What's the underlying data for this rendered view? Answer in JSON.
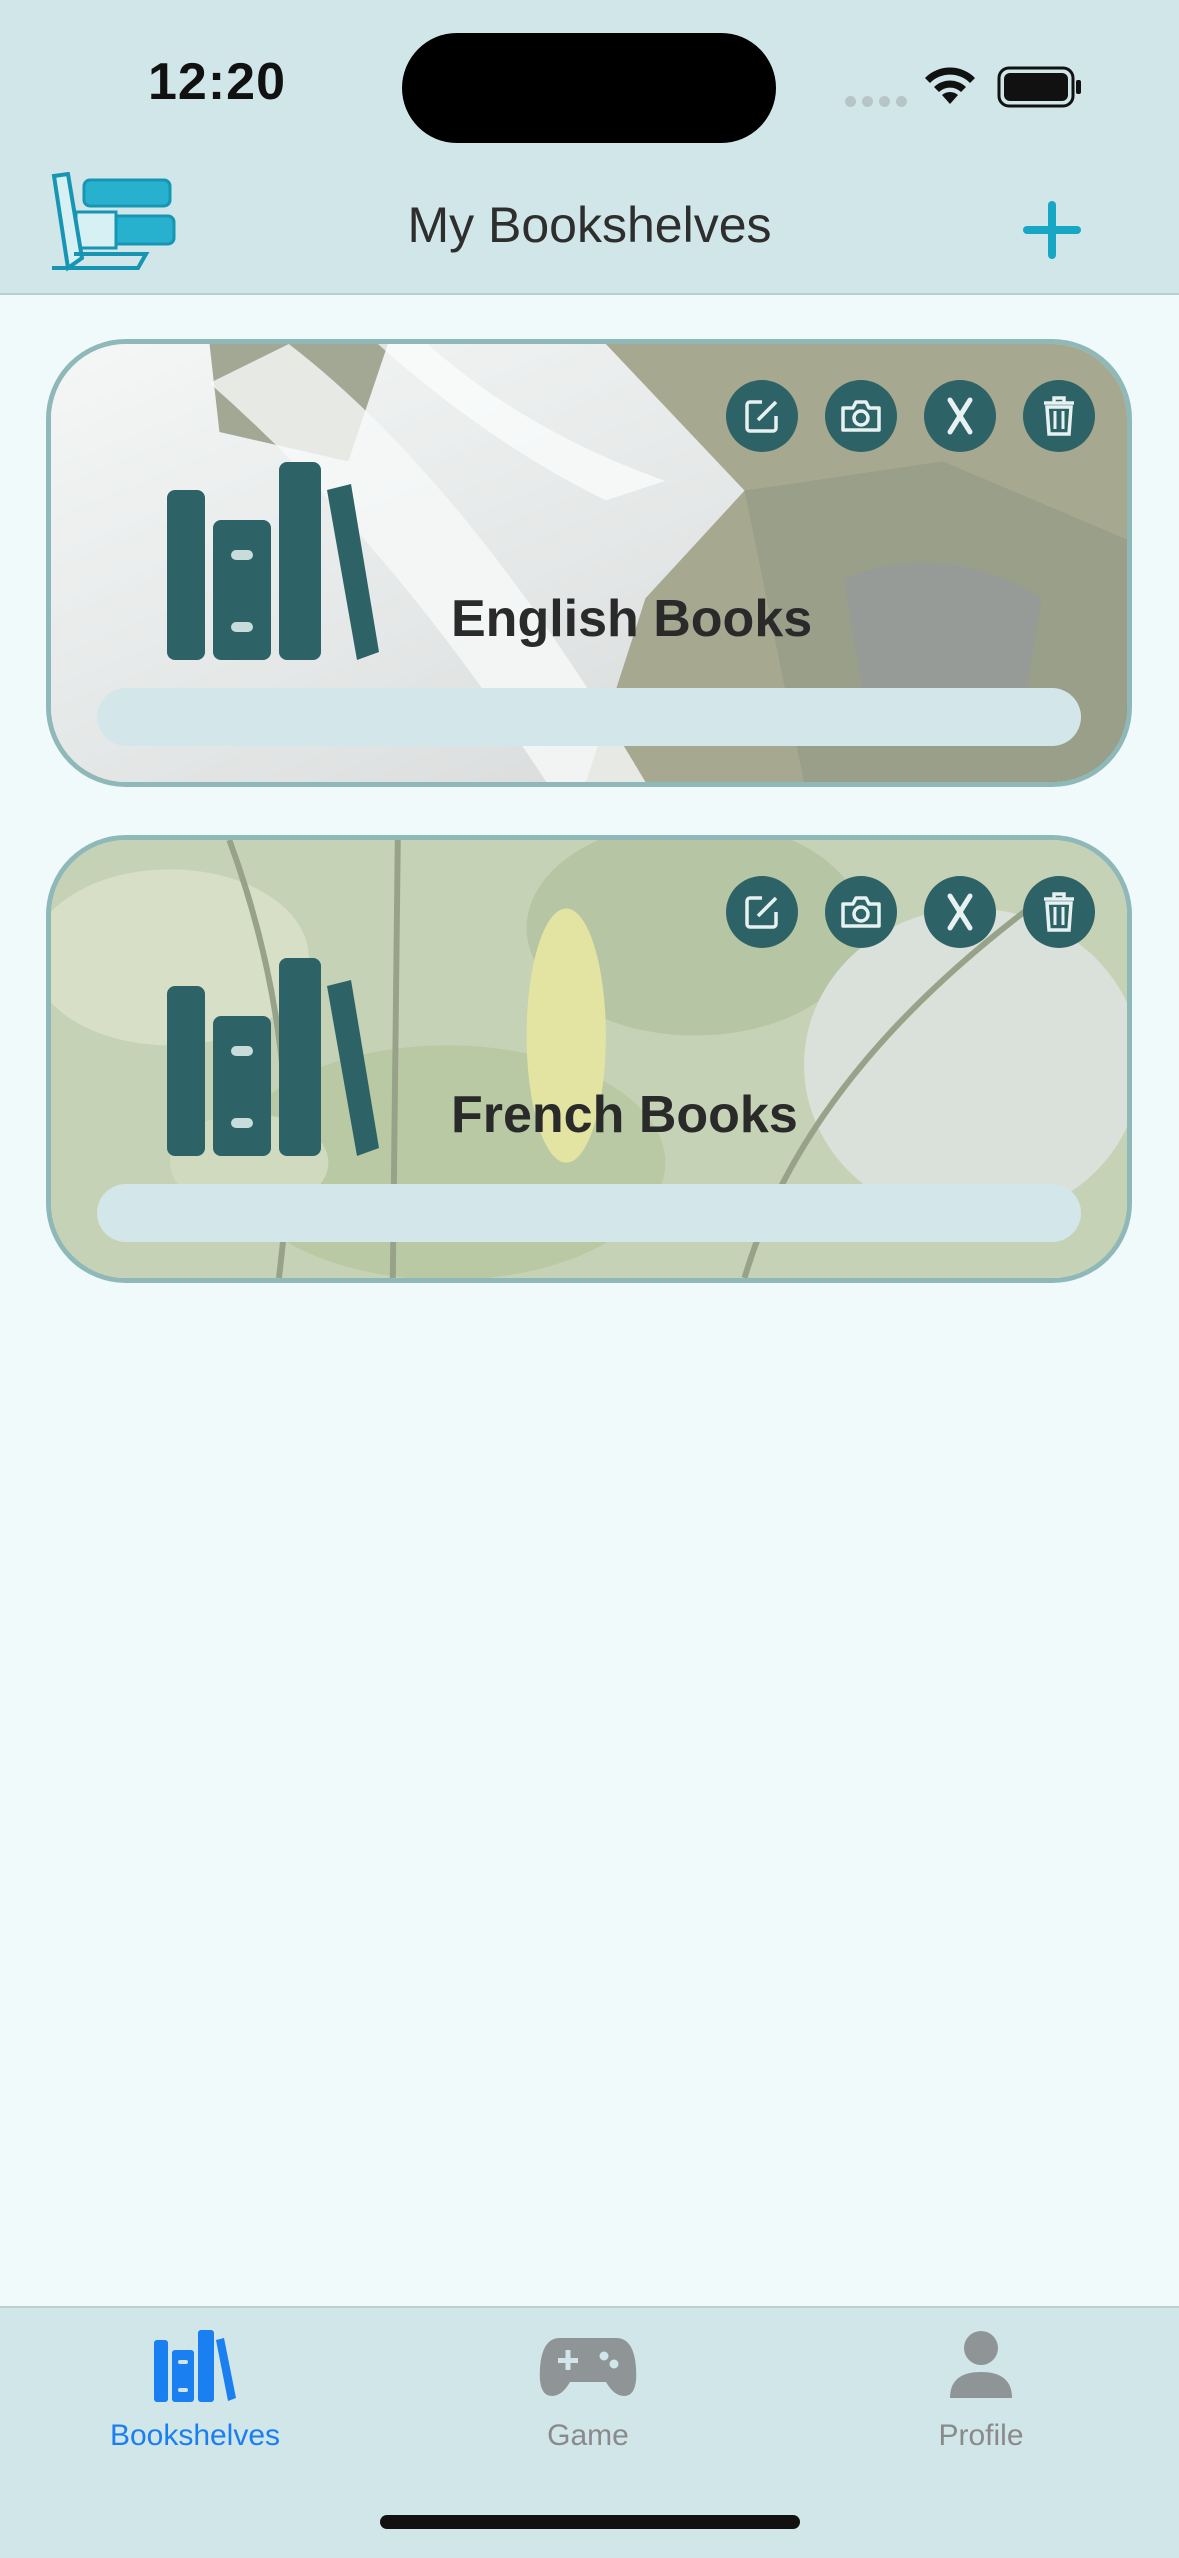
{
  "status_bar": {
    "time": "12:20"
  },
  "nav": {
    "title": "My Bookshelves",
    "add_icon": "plus-icon",
    "logo_icon": "bookshelf-logo-icon"
  },
  "shelves": [
    {
      "name": "English Books",
      "background": "waterfall-photo",
      "actions": [
        "edit-icon",
        "camera-icon",
        "x-icon",
        "trash-icon"
      ]
    },
    {
      "name": "French Books",
      "background": "leaves-photo",
      "actions": [
        "edit-icon",
        "camera-icon",
        "x-icon",
        "trash-icon"
      ]
    }
  ],
  "tabs": [
    {
      "label": "Bookshelves",
      "icon": "books-icon",
      "active": true
    },
    {
      "label": "Game",
      "icon": "gamepad-icon",
      "active": false
    },
    {
      "label": "Profile",
      "icon": "person-icon",
      "active": false
    }
  ],
  "colors": {
    "header_bg": "#d0e6e9",
    "page_bg": "#f1fafa",
    "accent": "#17a6c4",
    "icon_dark": "#2d6266",
    "tab_active": "#1a7ff0",
    "tab_inactive": "#8a8a8a"
  }
}
